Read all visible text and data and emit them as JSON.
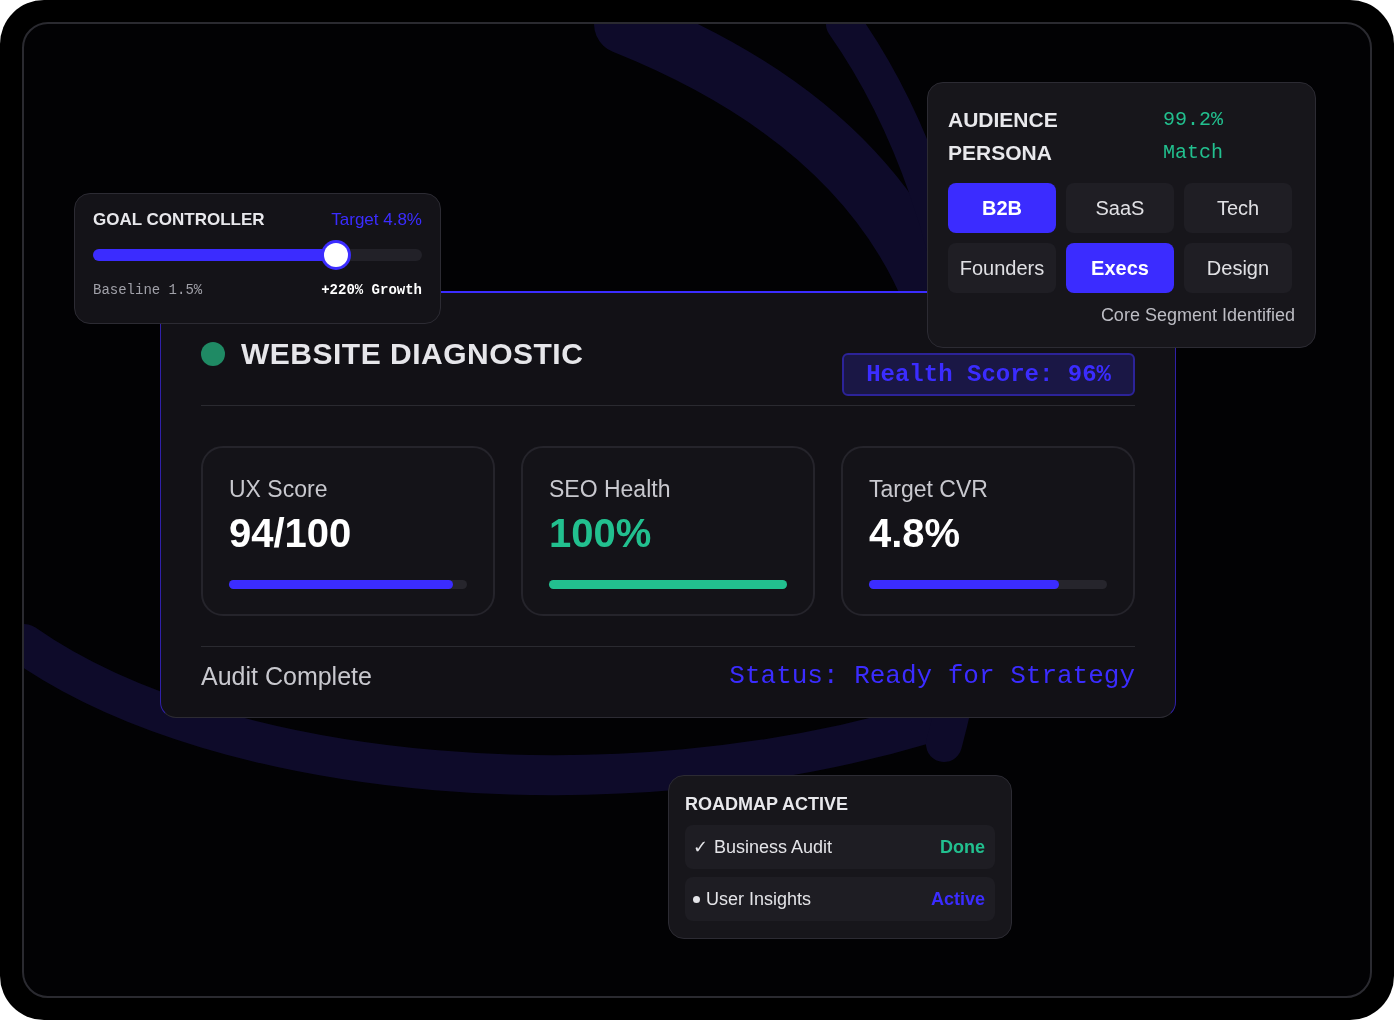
{
  "goal_controller": {
    "title": "GOAL CONTROLLER",
    "target": "Target 4.8%",
    "level": 0.74,
    "baseline": "Baseline 1.5%",
    "growth": "+220% Growth"
  },
  "diagnostic": {
    "title": "WEBSITE DIAGNOSTIC",
    "badge": "Health Score: 96%",
    "metrics": [
      {
        "label": "UX Score",
        "value": "94/100",
        "level": 0.94,
        "color": "#3b2cff"
      },
      {
        "label": "SEO Health",
        "value": "100%",
        "level": 1.0,
        "color": "#22c08f"
      },
      {
        "label": "Target CVR",
        "value": "4.8%",
        "level": 0.8,
        "color": "#3b2cff"
      }
    ],
    "footer_left": "Audit Complete",
    "footer_right": "Status: Ready for Strategy"
  },
  "persona": {
    "title_lines": [
      "AUDIENCE",
      "PERSONA"
    ],
    "match_lines": [
      "99.2%",
      "Match"
    ],
    "chips": [
      {
        "label": "B2B",
        "selected": true
      },
      {
        "label": "SaaS",
        "selected": false
      },
      {
        "label": "Tech",
        "selected": false
      },
      {
        "label": "Founders",
        "selected": false
      },
      {
        "label": "Execs",
        "selected": true
      },
      {
        "label": "Design",
        "selected": false
      }
    ],
    "caption": "Core Segment Identified"
  },
  "roadmap": {
    "title": "ROADMAP ACTIVE",
    "items": [
      {
        "kind": "check",
        "mark": "✓",
        "label": "Business Audit",
        "status": "Done",
        "color": "#22c08f"
      },
      {
        "kind": "bullet",
        "label": "User Insights",
        "status": "Active",
        "color": "#3b2cff"
      }
    ]
  }
}
